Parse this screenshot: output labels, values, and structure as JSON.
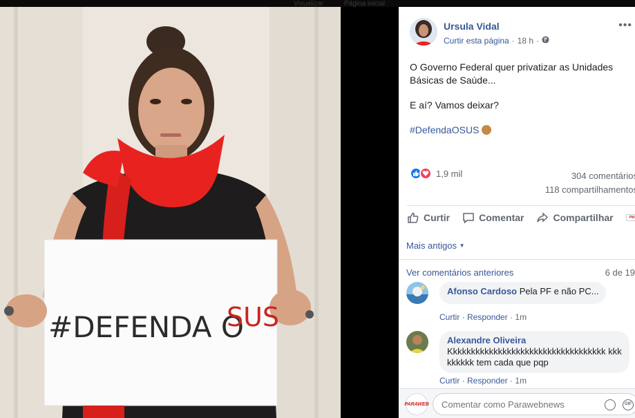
{
  "topbar": {
    "left_faint": "Visualizar",
    "right_faint": "Página inicial"
  },
  "photo": {
    "sign_text": "#DEFENDA O",
    "sign_text_red": "SUS"
  },
  "post": {
    "author": "Ursula Vidal",
    "like_page": "Curtir esta página",
    "separator": "·",
    "time": "18 h",
    "time_sep": "·",
    "privacy_icon": "globe-icon",
    "more_icon": "more-icon",
    "paragraph1": "O Governo Federal quer privatizar as Unidades Básicas de Saúde...",
    "paragraph2": "E aí? Vamos deixar?",
    "hashtag": "#DefendaOSUS",
    "emoji": "fist-emoji"
  },
  "stats": {
    "reactions_count": "1,9 mil",
    "comments_count": "304 comentários",
    "shares_count": "118 compartilhamentos"
  },
  "actions": {
    "like": "Curtir",
    "comment": "Comentar",
    "share": "Compartilhar"
  },
  "comments": {
    "filter_label": "Mais antigos",
    "view_previous": "Ver comentários anteriores",
    "count_label": "6 de 19",
    "items": [
      {
        "name": "Afonso Cardoso",
        "text": "Pela PF e não PC...",
        "like": "Curtir",
        "reply": "Responder",
        "time": "1m"
      },
      {
        "name": "Alexandre Oliveira",
        "text": "Kkkkkkkkkkkkkkkkkkkkkkkkkkkkkkkkkkk kkkkkkkkk tem cada que pqp",
        "like": "Curtir",
        "reply": "Responder",
        "time": "1m"
      }
    ],
    "composer_placeholder": "Comentar como Parawebnews",
    "self_badge": "PARAWEB"
  },
  "colors": {
    "link": "#365899",
    "like_blue": "#1877f2",
    "love_red": "#f33e58",
    "scarf_red": "#e8231f"
  }
}
